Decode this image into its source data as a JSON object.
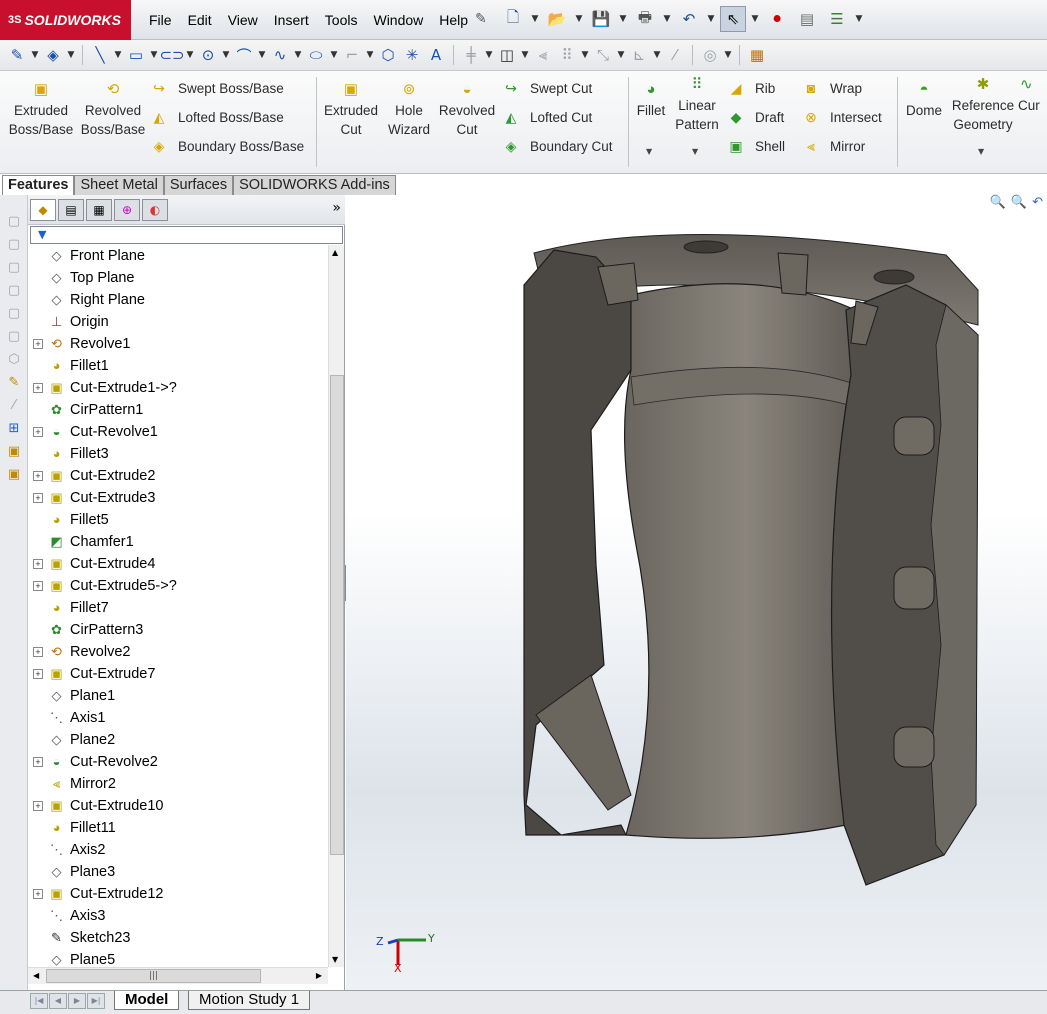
{
  "app": {
    "logo_text": "SOLIDWORKS",
    "logo_prefix": "3S"
  },
  "menu": [
    "File",
    "Edit",
    "View",
    "Insert",
    "Tools",
    "Window",
    "Help"
  ],
  "command_manager": {
    "extruded_boss": "Extruded Boss/Base",
    "revolved_boss": "Revolved Boss/Base",
    "swept_boss": "Swept Boss/Base",
    "lofted_boss": "Lofted Boss/Base",
    "boundary_boss": "Boundary Boss/Base",
    "extruded_cut": "Extruded Cut",
    "hole_wizard": "Hole Wizard",
    "revolved_cut": "Revolved Cut",
    "swept_cut": "Swept Cut",
    "lofted_cut": "Lofted Cut",
    "boundary_cut": "Boundary Cut",
    "fillet": "Fillet",
    "linear_pattern": "Linear Pattern",
    "rib": "Rib",
    "draft": "Draft",
    "shell": "Shell",
    "wrap": "Wrap",
    "intersect": "Intersect",
    "mirror": "Mirror",
    "dome": "Dome",
    "reference_geometry": "Reference Geometry",
    "curves": "Cur"
  },
  "tabs": [
    "Features",
    "Sheet Metal",
    "Surfaces",
    "SOLIDWORKS Add-ins"
  ],
  "tree": [
    {
      "label": "Front Plane",
      "icon": "plane-icon",
      "exp": false
    },
    {
      "label": "Top Plane",
      "icon": "plane-icon",
      "exp": false
    },
    {
      "label": "Right Plane",
      "icon": "plane-icon",
      "exp": false
    },
    {
      "label": "Origin",
      "icon": "origin-icon",
      "exp": false
    },
    {
      "label": "Revolve1",
      "icon": "revolve-icon",
      "exp": true
    },
    {
      "label": "Fillet1",
      "icon": "fillet-icon",
      "exp": false
    },
    {
      "label": "Cut-Extrude1->?",
      "icon": "cut-extrude-icon",
      "exp": true
    },
    {
      "label": "CirPattern1",
      "icon": "circular-pattern-icon",
      "exp": false
    },
    {
      "label": "Cut-Revolve1",
      "icon": "cut-revolve-icon",
      "exp": true
    },
    {
      "label": "Fillet3",
      "icon": "fillet-icon",
      "exp": false
    },
    {
      "label": "Cut-Extrude2",
      "icon": "cut-extrude-icon",
      "exp": true
    },
    {
      "label": "Cut-Extrude3",
      "icon": "cut-extrude-icon",
      "exp": true
    },
    {
      "label": "Fillet5",
      "icon": "fillet-icon",
      "exp": false
    },
    {
      "label": "Chamfer1",
      "icon": "chamfer-icon",
      "exp": false
    },
    {
      "label": "Cut-Extrude4",
      "icon": "cut-extrude-icon",
      "exp": true
    },
    {
      "label": "Cut-Extrude5->?",
      "icon": "cut-extrude-icon",
      "exp": true
    },
    {
      "label": "Fillet7",
      "icon": "fillet-icon",
      "exp": false
    },
    {
      "label": "CirPattern3",
      "icon": "circular-pattern-icon",
      "exp": false
    },
    {
      "label": "Revolve2",
      "icon": "revolve-icon",
      "exp": true
    },
    {
      "label": "Cut-Extrude7",
      "icon": "cut-extrude-icon",
      "exp": true
    },
    {
      "label": "Plane1",
      "icon": "plane-icon",
      "exp": false
    },
    {
      "label": "Axis1",
      "icon": "axis-icon",
      "exp": false
    },
    {
      "label": "Plane2",
      "icon": "plane-icon",
      "exp": false
    },
    {
      "label": "Cut-Revolve2",
      "icon": "cut-revolve-icon",
      "exp": true
    },
    {
      "label": "Mirror2",
      "icon": "mirror-icon",
      "exp": false
    },
    {
      "label": "Cut-Extrude10",
      "icon": "cut-extrude-icon",
      "exp": true
    },
    {
      "label": "Fillet11",
      "icon": "fillet-icon",
      "exp": false
    },
    {
      "label": "Axis2",
      "icon": "axis-icon",
      "exp": false
    },
    {
      "label": "Plane3",
      "icon": "plane-icon",
      "exp": false
    },
    {
      "label": "Cut-Extrude12",
      "icon": "cut-extrude-icon",
      "exp": true
    },
    {
      "label": "Axis3",
      "icon": "axis-icon",
      "exp": false
    },
    {
      "label": "Sketch23",
      "icon": "sketch-icon",
      "exp": false
    },
    {
      "label": "Plane5",
      "icon": "plane-icon",
      "exp": false
    }
  ],
  "bottom_tabs": [
    "Model",
    "Motion Study 1"
  ],
  "triad": {
    "x": "X",
    "y": "Y",
    "z": "Z"
  },
  "colors": {
    "accent": "#c8102e",
    "model": "#5b5853",
    "feature_icon": "#d8a800"
  }
}
